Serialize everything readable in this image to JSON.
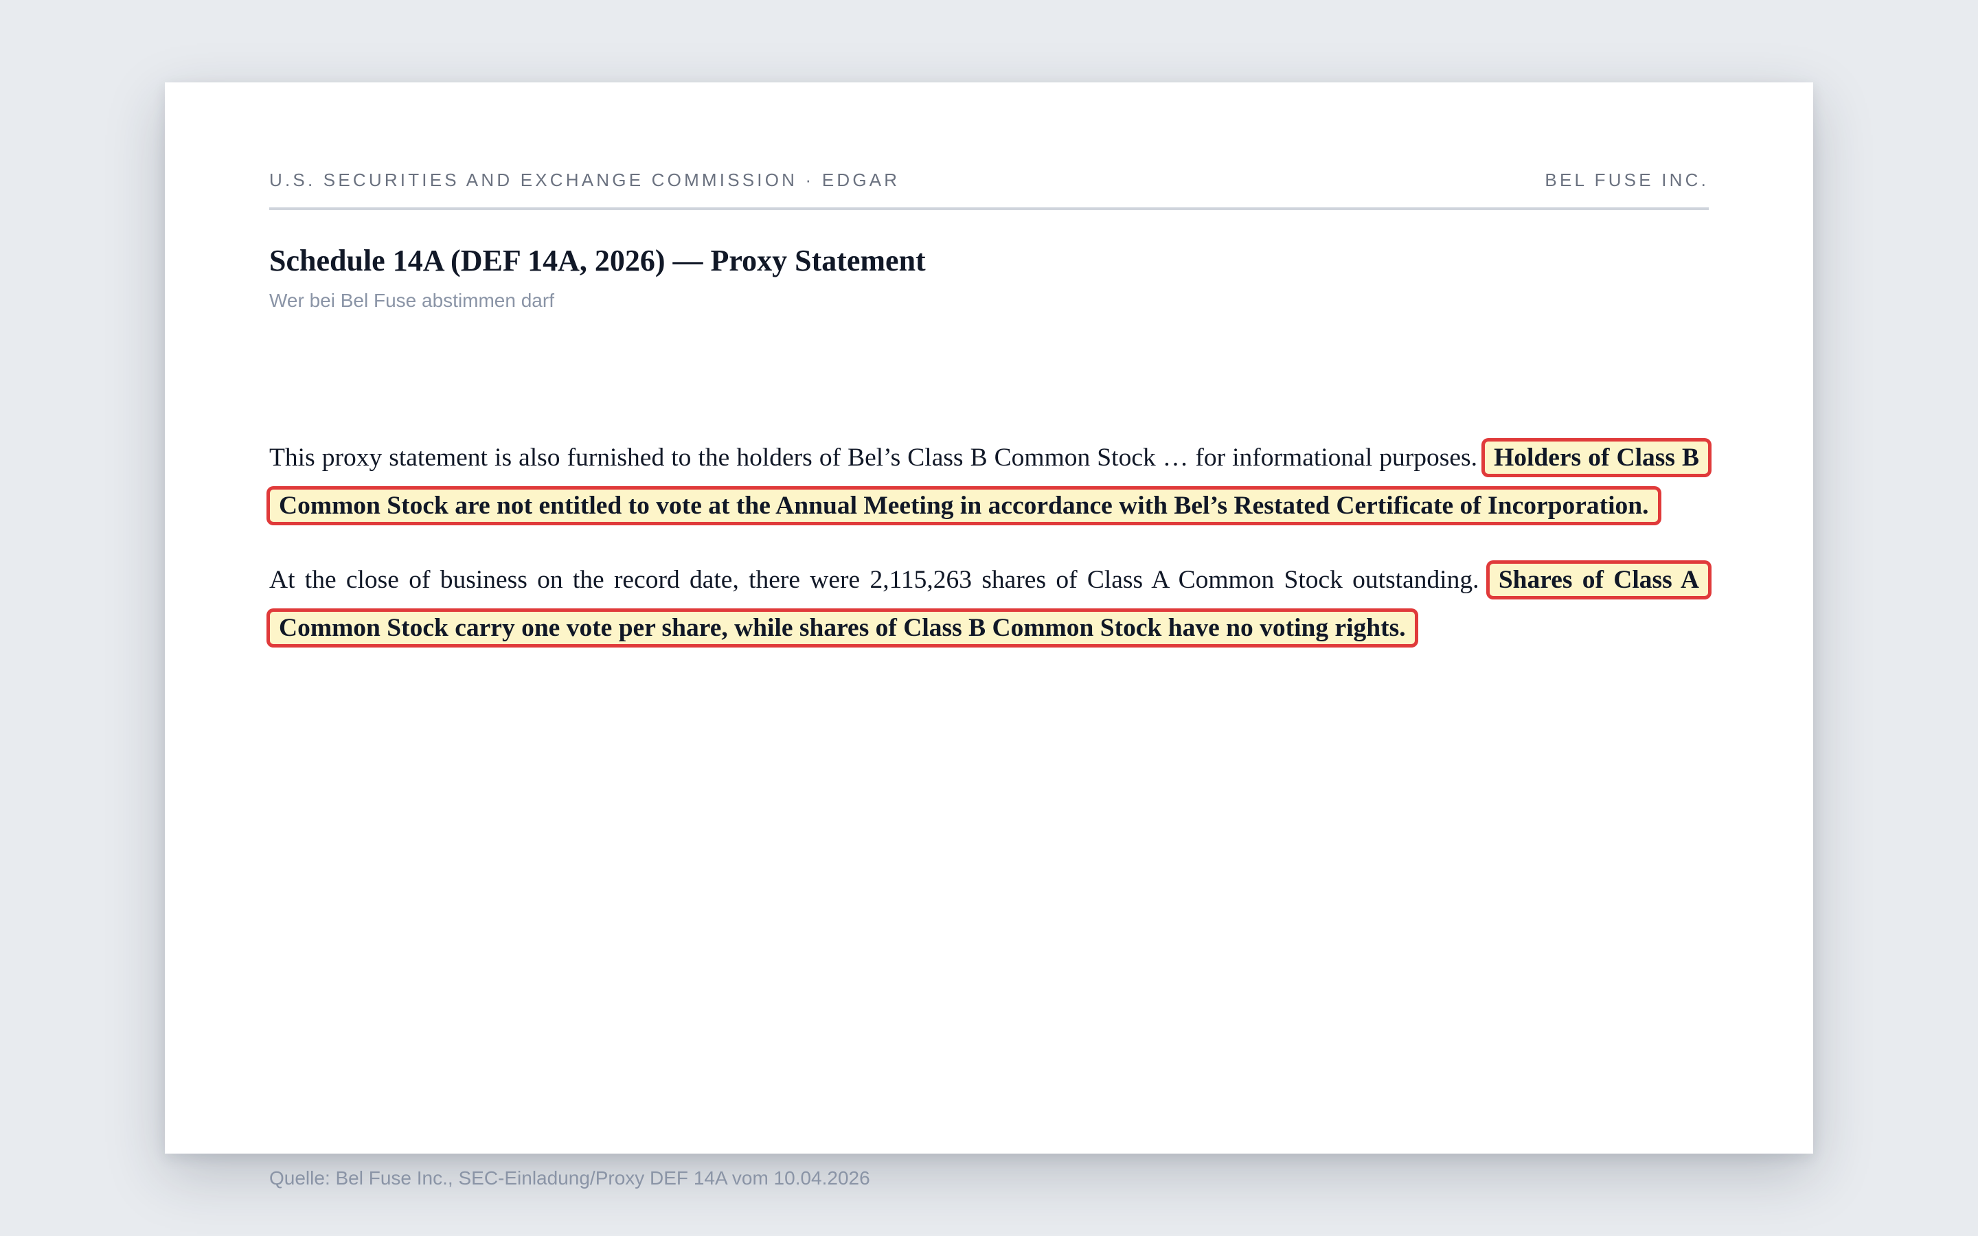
{
  "header": {
    "left": "U.S. SECURITIES AND EXCHANGE COMMISSION · EDGAR",
    "right": "BEL FUSE INC."
  },
  "title": "Schedule 14A (DEF 14A, 2026) — Proxy Statement",
  "subtitle": "Wer bei Bel Fuse abstimmen darf",
  "paragraphs": [
    {
      "text": "This proxy statement is also furnished to the holders of Bel’s Class B Common Stock … for informational purposes.",
      "highlight": "Holders of Class B Common Stock are not entitled to vote at the Annual Meeting in accordance with Bel’s Restated Certificate of Incorporation."
    },
    {
      "text": "At the close of business on the record date, there were 2,115,263 shares of Class A Common Stock outstanding.",
      "highlight": "Shares of Class A Common Stock carry one vote per share, while shares of Class B Common Stock have no voting rights."
    }
  ],
  "source": "Quelle: Bel Fuse Inc., SEC-Einladung/Proxy DEF 14A vom 10.04.2026",
  "colors": {
    "highlight_fill": "#fdf5c9",
    "highlight_border": "#e03a3a"
  }
}
